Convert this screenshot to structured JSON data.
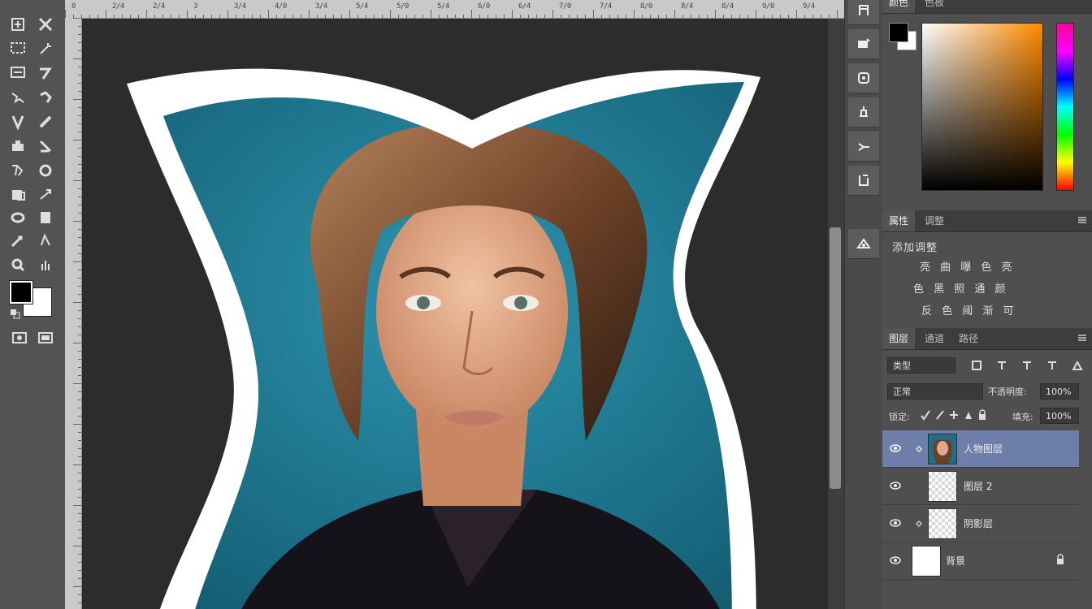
{
  "ruler": {
    "labels": [
      "0",
      "2/4",
      "2/4",
      "3",
      "3/4",
      "4/0",
      "3/4",
      "5/4",
      "5/0",
      "5/4",
      "6/0",
      "6/4",
      "7/0",
      "7/4",
      "8/0",
      "8/4",
      "8/4",
      "9/0",
      "9/4"
    ]
  },
  "colors": {
    "foreground": "#000000",
    "background": "#ffffff",
    "workspace": "#2c2c2c",
    "photo_bg": "#1f7f99",
    "selected_layer": "#6d7fa9"
  },
  "toolbar": {
    "tools": [
      "move-tool",
      "artboard-tool",
      "marquee-tool",
      "lasso-tool",
      "quick-select-tool",
      "crop-tool",
      "frame-tool",
      "eyedropper-tool",
      "heal-tool",
      "brush-tool",
      "stamp-tool",
      "history-brush-tool",
      "eraser-tool",
      "gradient-tool",
      "blur-tool",
      "dodge-tool",
      "pen-tool",
      "type-tool",
      "path-select-tool",
      "shape-tool",
      "hand-tool",
      "zoom-tool"
    ]
  },
  "color_panel": {
    "tab_active": "颜色",
    "tab_inactive": "色板"
  },
  "properties_panel": {
    "tabs": [
      "属性",
      "调整"
    ],
    "heading": "添加调整",
    "rows": [
      "亮 曲 曝 色 亮",
      "色 黑 照 通 颜",
      "反 色 阈 渐 可"
    ]
  },
  "layers_panel": {
    "tabs": [
      "图层",
      "通道",
      "路径"
    ],
    "filter_kind": "类型",
    "blend_mode": "正常",
    "opacity_label": "不透明度:",
    "opacity_value": "100%",
    "lock_label": "锁定:",
    "fill_label": "填充:",
    "fill_value": "100%",
    "layers": [
      {
        "name": "人物图层",
        "selected": true,
        "thumb": "portrait"
      },
      {
        "name": "图层 2",
        "selected": false,
        "thumb": "transparent"
      },
      {
        "name": "阴影层",
        "selected": false,
        "thumb": "transparent"
      },
      {
        "name": "背景",
        "selected": false,
        "thumb": "white",
        "locked": true
      }
    ]
  }
}
